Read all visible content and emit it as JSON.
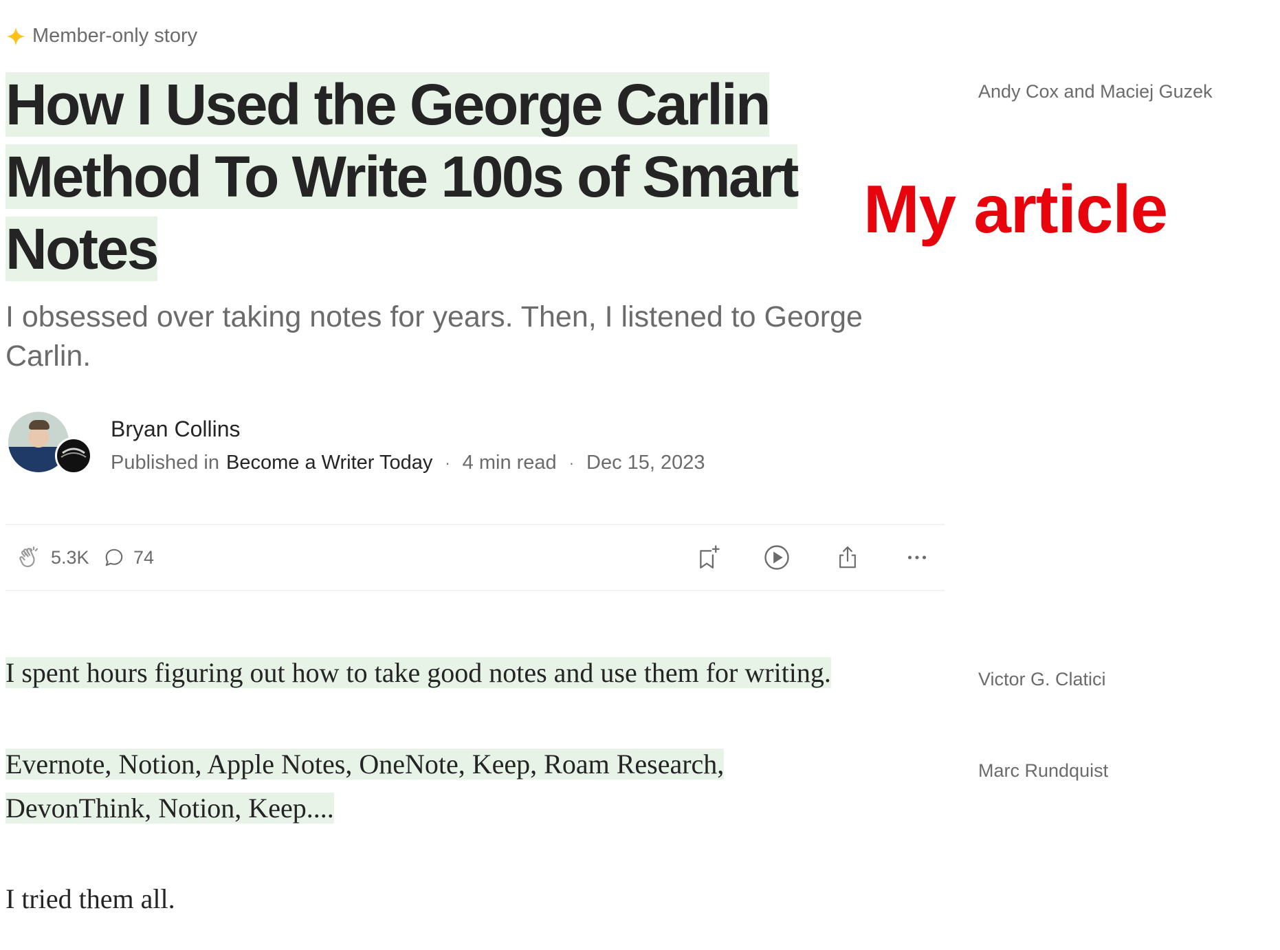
{
  "member_badge": {
    "icon": "sparkle-icon",
    "label": "Member-only story",
    "icon_color": "#ffc017"
  },
  "article": {
    "title": "How I Used the George Carlin Method To Write 100s of Smart Notes",
    "subtitle": "I obsessed over taking notes for years. Then, I listened to George Carlin.",
    "highlight_color": "#e8f3e8",
    "paragraphs": [
      "I spent hours figuring out how to take good notes and use them for writing.",
      "Evernote, Notion, Apple Notes, OneNote, Keep, Roam Research, DevonThink, Notion, Keep....",
      "I tried them all."
    ]
  },
  "author": {
    "name": "Bryan Collins",
    "published_in_label": "Published in",
    "publication": "Become a Writer Today",
    "read_time": "4 min read",
    "date": "Dec 15, 2023",
    "separator": "·"
  },
  "actions": {
    "claps": "5.3K",
    "responses": "74",
    "icons": [
      "clap-icon",
      "comment-icon",
      "bookmark-add-icon",
      "play-icon",
      "share-icon",
      "more-icon"
    ]
  },
  "annotation": {
    "label": "My article",
    "color": "#e8040c"
  },
  "sidebar": {
    "names": [
      "Andy Cox and Maciej Guzek",
      "Victor G. Clatici",
      "Marc Rundquist"
    ]
  }
}
